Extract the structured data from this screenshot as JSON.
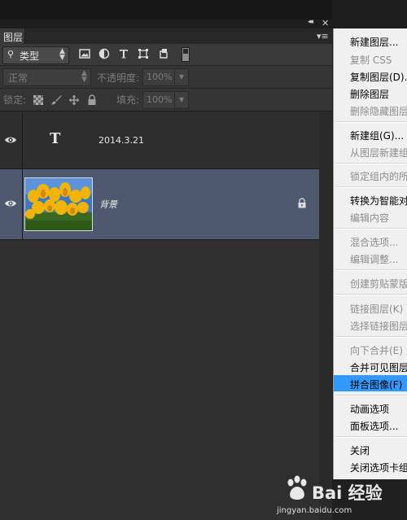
{
  "panel": {
    "tab_label": "图层",
    "filter": {
      "selected": "类型"
    },
    "blend_mode": "正常",
    "opacity_label": "不透明度:",
    "opacity_value": "100%",
    "lock_label": "锁定:",
    "fill_label": "填充:",
    "fill_value": "100%"
  },
  "layers": [
    {
      "name": "2014.3.21",
      "type": "text",
      "visible": true,
      "selected": false
    },
    {
      "name": "背景",
      "type": "image",
      "visible": true,
      "selected": true,
      "locked": true
    }
  ],
  "context_menu": {
    "items": [
      {
        "label": "新建图层...",
        "enabled": true
      },
      {
        "label": "复制 CSS",
        "enabled": false
      },
      {
        "label": "复制图层(D)...",
        "enabled": true
      },
      {
        "label": "删除图层",
        "enabled": true
      },
      {
        "label": "删除隐藏图层",
        "enabled": false
      },
      {
        "label": "新建组(G)...",
        "enabled": true
      },
      {
        "label": "从图层新建组...",
        "enabled": false
      },
      {
        "label": "锁定组内的所有图层...",
        "enabled": false
      },
      {
        "label": "转换为智能对象",
        "enabled": true
      },
      {
        "label": "编辑内容",
        "enabled": false
      },
      {
        "label": "混合选项...",
        "enabled": false
      },
      {
        "label": "编辑调整...",
        "enabled": false
      },
      {
        "label": "创建剪贴蒙版",
        "enabled": false
      },
      {
        "label": "链接图层(K)",
        "enabled": false
      },
      {
        "label": "选择链接图层(S)",
        "enabled": false
      },
      {
        "label": "向下合并(E)",
        "enabled": false
      },
      {
        "label": "合并可见图层",
        "enabled": true
      },
      {
        "label": "拼合图像(F)",
        "enabled": true,
        "highlighted": true
      },
      {
        "label": "动画选项",
        "enabled": true
      },
      {
        "label": "面板选项...",
        "enabled": true
      },
      {
        "label": "关闭",
        "enabled": true
      },
      {
        "label": "关闭选项卡组",
        "enabled": true
      }
    ]
  },
  "colors": {
    "selected_layer": "#4e596f",
    "menu_highlight": "#3399ff",
    "panel_bg": "#2f2f2f"
  },
  "watermark": {
    "brand": "Bai 经验",
    "url": "jingyan.baidu.com"
  }
}
